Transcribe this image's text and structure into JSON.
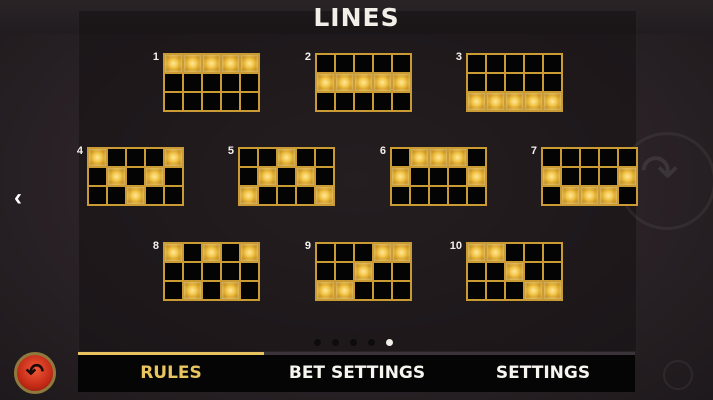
{
  "title": "LINES",
  "nav": {
    "prev_icon": "chevron-left-icon",
    "next_icon": "curved-arrow-icon"
  },
  "lines": [
    {
      "label": "1",
      "pattern": [
        1,
        1,
        1,
        1,
        1,
        0,
        0,
        0,
        0,
        0,
        0,
        0,
        0,
        0,
        0
      ]
    },
    {
      "label": "2",
      "pattern": [
        0,
        0,
        0,
        0,
        0,
        1,
        1,
        1,
        1,
        1,
        0,
        0,
        0,
        0,
        0
      ]
    },
    {
      "label": "3",
      "pattern": [
        0,
        0,
        0,
        0,
        0,
        0,
        0,
        0,
        0,
        0,
        1,
        1,
        1,
        1,
        1
      ]
    },
    {
      "label": "4",
      "pattern": [
        1,
        0,
        0,
        0,
        1,
        0,
        1,
        0,
        1,
        0,
        0,
        0,
        1,
        0,
        0
      ]
    },
    {
      "label": "5",
      "pattern": [
        0,
        0,
        1,
        0,
        0,
        0,
        1,
        0,
        1,
        0,
        1,
        0,
        0,
        0,
        1
      ]
    },
    {
      "label": "6",
      "pattern": [
        0,
        1,
        1,
        1,
        0,
        1,
        0,
        0,
        0,
        1,
        0,
        0,
        0,
        0,
        0
      ]
    },
    {
      "label": "7",
      "pattern": [
        0,
        0,
        0,
        0,
        0,
        1,
        0,
        0,
        0,
        1,
        0,
        1,
        1,
        1,
        0
      ]
    },
    {
      "label": "8",
      "pattern": [
        1,
        0,
        1,
        0,
        1,
        0,
        0,
        0,
        0,
        0,
        0,
        1,
        0,
        1,
        0
      ]
    },
    {
      "label": "9",
      "pattern": [
        0,
        0,
        0,
        1,
        1,
        0,
        0,
        1,
        0,
        0,
        1,
        1,
        0,
        0,
        0
      ]
    },
    {
      "label": "10",
      "pattern": [
        1,
        1,
        0,
        0,
        0,
        0,
        0,
        1,
        0,
        0,
        0,
        0,
        0,
        1,
        1
      ]
    }
  ],
  "pager": {
    "count": 5,
    "active_index": 4
  },
  "tabs": [
    {
      "label": "RULES",
      "active": true
    },
    {
      "label": "BET SETTINGS",
      "active": false
    },
    {
      "label": "SETTINGS",
      "active": false
    }
  ],
  "colors": {
    "gold": "#c99b32",
    "active_tab": "#e9c55f",
    "back_button": "#c42a16"
  },
  "back_button_icon": "undo-arrow-icon"
}
